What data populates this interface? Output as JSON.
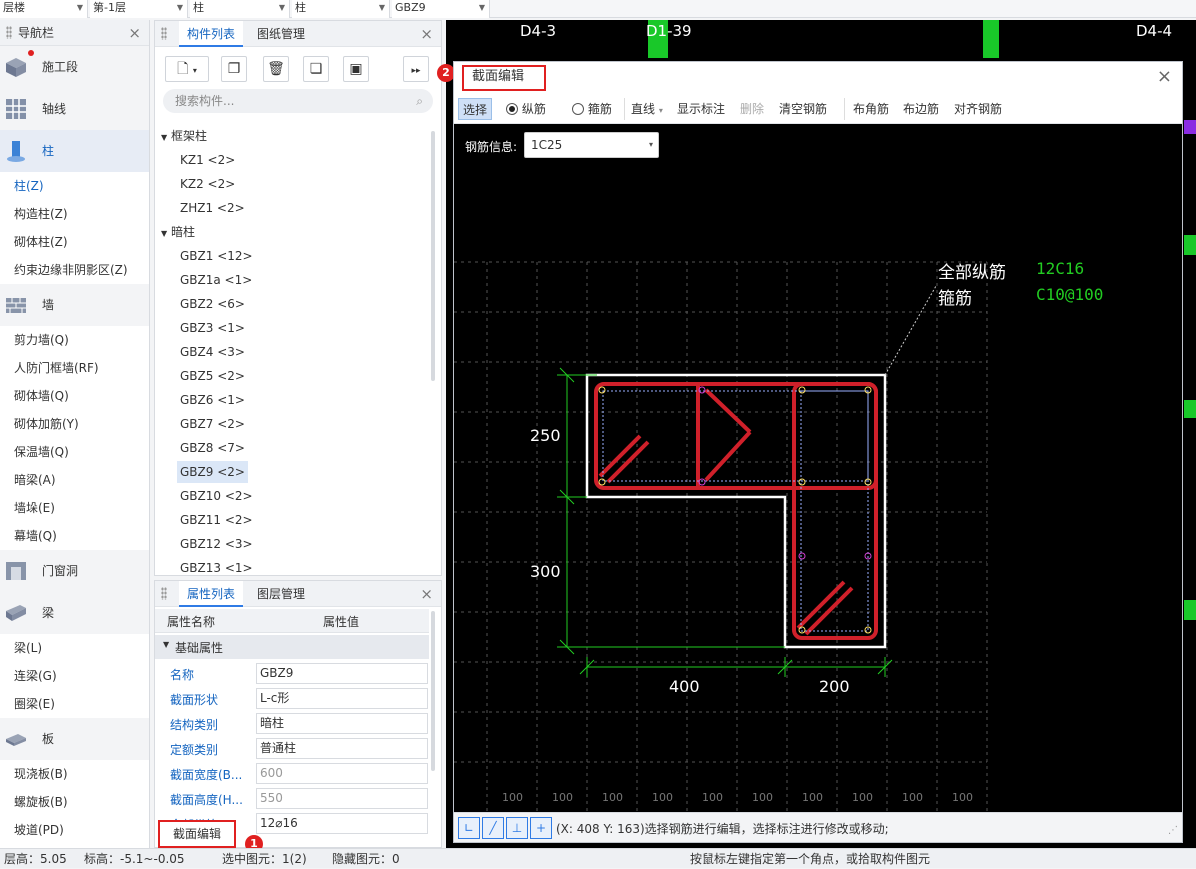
{
  "topbar": {
    "dd1": "层楼",
    "dd2": "第-1层",
    "dd3": "柱",
    "dd4": "柱",
    "dd5": "GBZ9"
  },
  "nav": {
    "title": "导航栏",
    "cats": [
      {
        "label": "施工段",
        "icon": "construction-stage-icon"
      },
      {
        "label": "轴线",
        "icon": "axis-grid-icon"
      },
      {
        "label": "柱",
        "icon": "column-icon"
      }
    ],
    "col_items": [
      "柱(Z)",
      "构造柱(Z)",
      "砌体柱(Z)",
      "约束边缘非阴影区(Z)"
    ],
    "wall": "墙",
    "wall_items": [
      "剪力墙(Q)",
      "人防门框墙(RF)",
      "砌体墙(Q)",
      "砌体加筋(Y)",
      "保温墙(Q)",
      "暗梁(A)",
      "墙垛(E)",
      "幕墙(Q)"
    ],
    "door": "门窗洞",
    "beam": "梁",
    "beam_items": [
      "梁(L)",
      "连梁(G)",
      "圈梁(E)"
    ],
    "slab": "板",
    "slab_items": [
      "现浇板(B)",
      "螺旋板(B)",
      "坡道(PD)"
    ]
  },
  "comp": {
    "tab1": "构件列表",
    "tab2": "图纸管理",
    "search_placeholder": "搜索构件...",
    "group1": "框架柱",
    "group1_items": [
      "KZ1 <2>",
      "KZ2 <2>",
      "ZHZ1 <2>"
    ],
    "group2": "暗柱",
    "group2_items": [
      "GBZ1 <12>",
      "GBZ1a <1>",
      "GBZ2 <6>",
      "GBZ3 <1>",
      "GBZ4 <3>",
      "GBZ5 <2>",
      "GBZ6 <1>",
      "GBZ7 <2>",
      "GBZ8 <7>",
      "GBZ9 <2>",
      "GBZ10 <2>",
      "GBZ11 <2>",
      "GBZ12 <3>",
      "GBZ13 <1>"
    ]
  },
  "props": {
    "tab1": "属性列表",
    "tab2": "图层管理",
    "col_name": "属性名称",
    "col_value": "属性值",
    "section": "基础属性",
    "rows": [
      {
        "name": "名称",
        "value": "GBZ9"
      },
      {
        "name": "截面形状",
        "value": "L-c形"
      },
      {
        "name": "结构类别",
        "value": "暗柱"
      },
      {
        "name": "定额类别",
        "value": "普通柱"
      },
      {
        "name": "截面宽度(B...",
        "value": "600"
      },
      {
        "name": "截面高度(H...",
        "value": "550"
      },
      {
        "name": "全部纵筋",
        "value": "12⌀16"
      }
    ]
  },
  "edit_button": "截面编辑",
  "badge1": "1",
  "badge2": "2",
  "status": {
    "a": "层高：",
    "a_val": "5.05",
    "b": "标高：",
    "b_val": "-5.1~-0.05",
    "c": "选中图元：1(2)",
    "d": "隐藏图元：0",
    "hint": "按鼠标左键指定第一个角点，或拾取构件图元"
  },
  "cad_labels": [
    "D4-3",
    "D1-39",
    "D4-4"
  ],
  "dialog": {
    "title": "截面编辑",
    "tb_select": "选择",
    "tb_long": "纵筋",
    "tb_stirrup": "箍筋",
    "tb_line": "直线",
    "tb_show": "显示标注",
    "tb_delete": "删除",
    "tb_clear": "清空钢筋",
    "tb_corner": "布角筋",
    "tb_edge": "布边筋",
    "tb_align": "对齐钢筋",
    "rebar_label": "钢筋信息:",
    "rebar_value": "1C25",
    "ann_long_label": "全部纵筋",
    "ann_long_value": "12C16",
    "ann_stir_label": "箍筋",
    "ann_stir_value": "C10@100",
    "dim_250": "250",
    "dim_300": "300",
    "dim_400": "400",
    "dim_200": "200",
    "grid_label": "100",
    "hint": "(X: 408 Y: 163)选择钢筋进行编辑，选择标注进行修改或移动;"
  },
  "colors": {
    "accent": "#2f7be5",
    "rebar": "#d0202a",
    "dim": "#22cc22",
    "alert": "#e02020"
  }
}
